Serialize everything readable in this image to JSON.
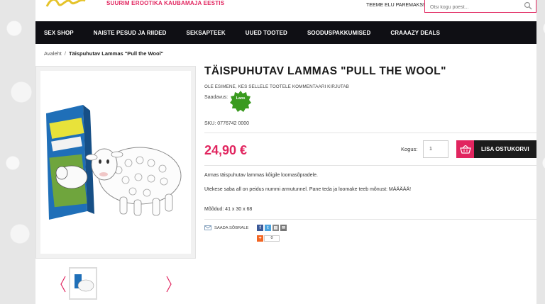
{
  "header": {
    "tagline": "SUURIM EROOTIKA KAUBAMAJA EESTIS",
    "slogan": "TEEME ELU PAREMAKS!",
    "search_placeholder": "Otsi kogu poest..."
  },
  "nav": {
    "items": [
      {
        "label": "SEX SHOP"
      },
      {
        "label": "NAISTE PESUD JA RIIDED"
      },
      {
        "label": "SEKSAPTEEK"
      },
      {
        "label": "UUED TOOTED"
      },
      {
        "label": "SOODUSPAKKUMISED"
      },
      {
        "label": "CRAAAZY DEALS"
      }
    ]
  },
  "breadcrumb": {
    "home": "Avaleht",
    "separator": "/",
    "current": "Täispuhutav Lammas \"Pull the Wool\""
  },
  "product": {
    "title": "TÄISPUHUTAV LAMMAS \"PULL THE WOOL\"",
    "first_review": "OLE ESIMENE, KES SELLELE TOOTELE KOMMENTAARI KIRJUTAB",
    "availability_label": "Saadavus:",
    "availability_badge": "Laos",
    "sku": "SKU: 0776742 0000",
    "price": "24,90 €",
    "quantity_label": "Kogus:",
    "quantity_value": "1",
    "add_to_cart": "LISA OSTUKORVI",
    "description_1": "Armas täispuhutav lammas kõigile loomasõpradele.",
    "description_2": "Utekese saba all on peidus nummi armutunnel. Pane teda ja loomake teeb mõnust: MÄÄÄÄÄ!",
    "dimensions": "Mõõdud: 41 x 30 x 68"
  },
  "share": {
    "label": "SAADA SÕBRALE",
    "plus": "+",
    "count": "0"
  },
  "colors": {
    "accent": "#e1255f",
    "nav_bg": "#0f0f14",
    "badge": "#3a9a1f"
  }
}
